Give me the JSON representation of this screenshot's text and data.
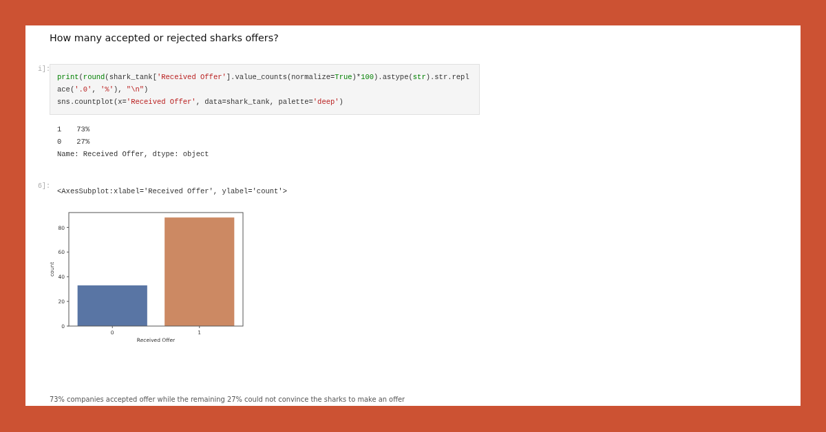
{
  "heading": "How many accepted or rejected sharks offers?",
  "cells": [
    {
      "prompt": "i]:",
      "code": [
        [
          {
            "t": "print",
            "kind": "builtin"
          },
          {
            "t": "(",
            "kind": "plain"
          },
          {
            "t": "round",
            "kind": "builtin"
          },
          {
            "t": "(shark_tank[",
            "kind": "plain"
          },
          {
            "t": "'Received Offer'",
            "kind": "string"
          },
          {
            "t": "].value_counts(normalize=",
            "kind": "plain"
          },
          {
            "t": "True",
            "kind": "builtin"
          },
          {
            "t": ")*",
            "kind": "plain"
          },
          {
            "t": "100",
            "kind": "number"
          },
          {
            "t": ").astype(",
            "kind": "plain"
          },
          {
            "t": "str",
            "kind": "builtin"
          },
          {
            "t": ").str.repl",
            "kind": "plain"
          }
        ],
        [
          {
            "t": "ace(",
            "kind": "plain"
          },
          {
            "t": "'.0'",
            "kind": "string"
          },
          {
            "t": ", ",
            "kind": "plain"
          },
          {
            "t": "'%'",
            "kind": "string"
          },
          {
            "t": "), ",
            "kind": "plain"
          },
          {
            "t": "\"\\n\"",
            "kind": "string"
          },
          {
            "t": ")",
            "kind": "plain"
          }
        ],
        [
          {
            "t": "sns.countplot(x=",
            "kind": "plain"
          },
          {
            "t": "'Received Offer'",
            "kind": "string"
          },
          {
            "t": ", data=shark_tank, palette=",
            "kind": "plain"
          },
          {
            "t": "'deep'",
            "kind": "string"
          },
          {
            "t": ")",
            "kind": "plain"
          }
        ]
      ],
      "output": [
        [
          "1",
          "73%"
        ],
        [
          "0",
          "27%"
        ],
        [
          "Name: Received Offer, dtype: object"
        ]
      ]
    },
    {
      "prompt": "6]:",
      "output": [
        [
          "<AxesSubplot:xlabel='Received Offer', ylabel='count'>"
        ]
      ],
      "chart_data": {
        "type": "bar",
        "xlabel": "Received Offer",
        "ylabel": "count",
        "categories": [
          "0",
          "1"
        ],
        "series": [
          {
            "color": "#5975a4",
            "values": [
              33,
              null
            ]
          },
          {
            "color": "#cc8963",
            "values": [
              null,
              88
            ]
          }
        ],
        "ylim": [
          0,
          92
        ],
        "yticks": [
          0,
          20,
          40,
          60,
          80
        ]
      }
    }
  ],
  "summary": "73% companies accepted offer while the remaining 27% could not convince the sharks to make an offer"
}
